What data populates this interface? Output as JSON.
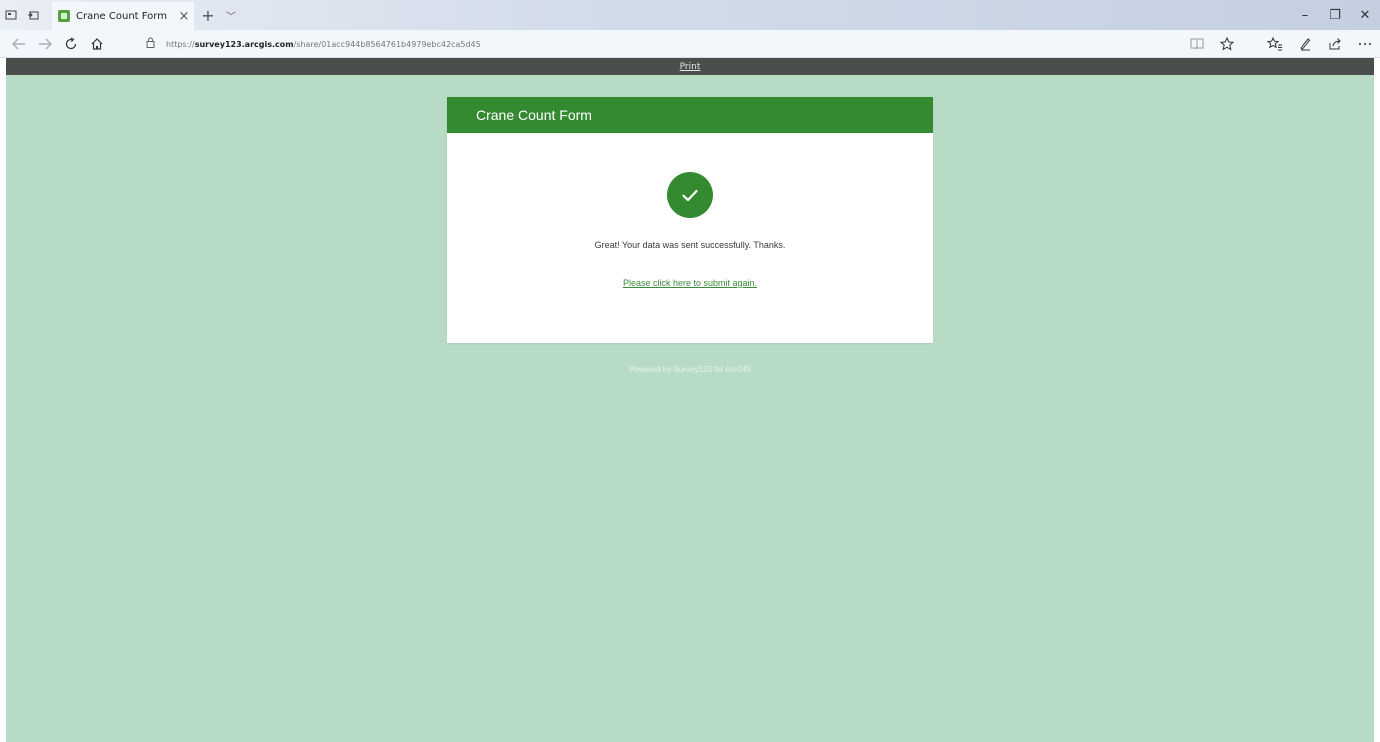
{
  "browser": {
    "tab_title": "Crane Count Form",
    "tab_close": "×",
    "new_tab": "+",
    "tab_list": "﹀",
    "window": {
      "minimize": "–",
      "restore": "❐",
      "close": "✕"
    },
    "url_prefix": "https://",
    "url_domain": "survey123.arcgis.com",
    "url_path": "/share/01acc944b8564761b4979ebc42ca5d45"
  },
  "page": {
    "print_label": "Print",
    "form_title": "Crane Count Form",
    "success_message": "Great! Your data was sent successfully. Thanks.",
    "submit_again_label": "Please click here to submit again.",
    "powered_by": "Powered by Survey123 for ArcGIS"
  },
  "colors": {
    "page_background": "#b8dbc6",
    "header_green": "#338a31",
    "print_bar": "#4a4f4b",
    "link_green": "#3c8a3a"
  },
  "icons": {
    "success": "check-icon",
    "back": "back-arrow-icon",
    "forward": "forward-arrow-icon",
    "refresh": "refresh-icon",
    "home": "home-icon",
    "lock": "lock-icon",
    "reading_view": "reading-view-icon",
    "favorite": "star-icon",
    "favorites_hub": "favorites-list-icon",
    "notes": "pen-icon",
    "share": "share-icon",
    "more": "more-icon"
  }
}
